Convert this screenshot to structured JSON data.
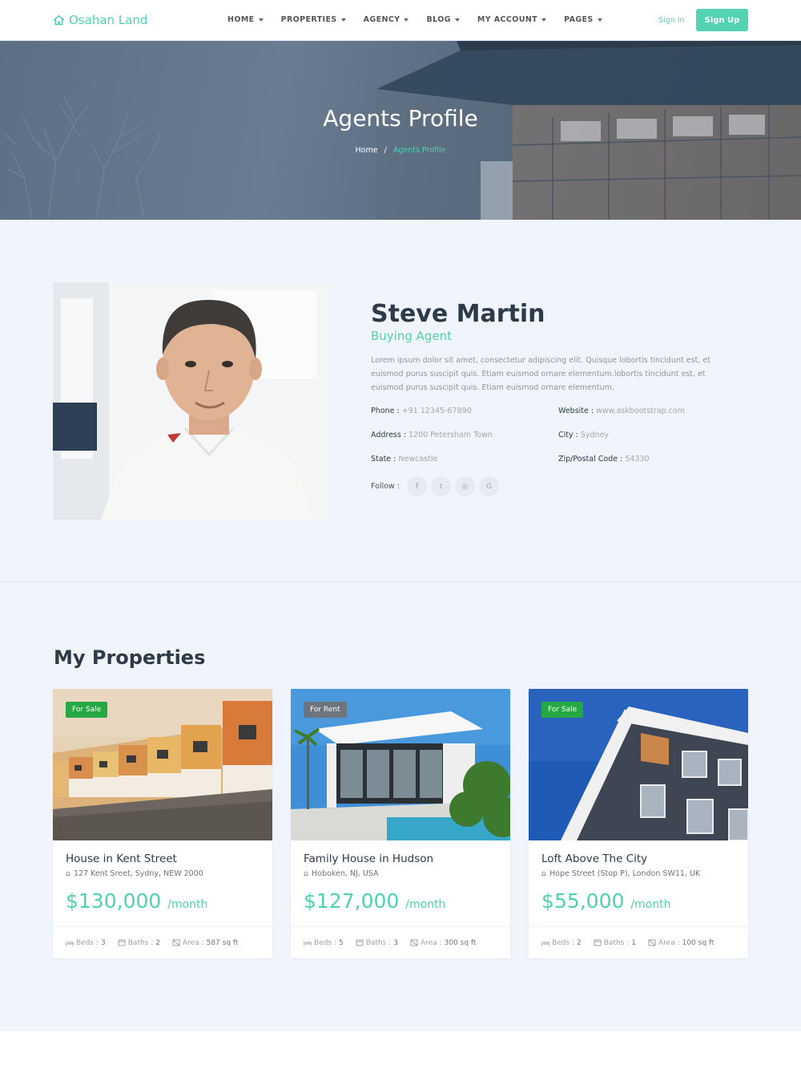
{
  "brand": {
    "name": "Osahan Land"
  },
  "nav": [
    {
      "label": "HOME"
    },
    {
      "label": "PROPERTIES"
    },
    {
      "label": "AGENCY"
    },
    {
      "label": "BLOG"
    },
    {
      "label": "MY ACCOUNT"
    },
    {
      "label": "PAGES"
    }
  ],
  "auth": {
    "sign_in": "Sign In",
    "sign_up": "Sign Up"
  },
  "hero": {
    "title": "Agents Profile",
    "crumb_home": "Home",
    "crumb_sep": "/",
    "crumb_active": "Agents Profile"
  },
  "agent": {
    "name": "Steve Martin",
    "role": "Buying Agent",
    "bio": "Lorem ipsum dolor sit amet, consectetur adipiscing elit. Quisque lobortis tincidunt est, et euismod purus suscipit quis. Etiam euismod ornare elementum.lobortis tincidunt est, et euismod purus suscipit quis. Etiam euismod ornare elementum.",
    "phone_label": "Phone :",
    "phone": "+91 12345-67890",
    "website_label": "Website :",
    "website": "www.askbootstrap.com",
    "address_label": "Address :",
    "address": "1200 Petersham Town",
    "city_label": "City :",
    "city": "Sydney",
    "state_label": "State :",
    "state": "Newcastle",
    "zip_label": "Zip/Postal Code :",
    "zip": "54330",
    "follow_label": "Follow :",
    "social": [
      {
        "icon": "facebook-icon",
        "glyph": "f"
      },
      {
        "icon": "twitter-icon",
        "glyph": "t"
      },
      {
        "icon": "instagram-icon",
        "glyph": "◎"
      },
      {
        "icon": "google-icon",
        "glyph": "G"
      }
    ]
  },
  "properties": {
    "title": "My Properties",
    "items": [
      {
        "badge": "For Sale",
        "title": "House in Kent Street",
        "address": "127 Kent Sreet, Sydny, NEW 2000",
        "price": "$130,000",
        "period": "/month",
        "beds_label": "Beds :",
        "beds": "3",
        "baths_label": "Baths :",
        "baths": "2",
        "area_label": "Area :",
        "area": "587 sq ft"
      },
      {
        "badge": "For Rent",
        "title": "Family House in Hudson",
        "address": "Hoboken, NJ, USA",
        "price": "$127,000",
        "period": "/month",
        "beds_label": "Beds :",
        "beds": "5",
        "baths_label": "Baths :",
        "baths": "3",
        "area_label": "Area :",
        "area": "300 sq ft"
      },
      {
        "badge": "For Sale",
        "title": "Loft Above The City",
        "address": "Hope Street (Stop P), London SW11, UK",
        "price": "$55,000",
        "period": "/month",
        "beds_label": "Beds :",
        "beds": "2",
        "baths_label": "Baths :",
        "baths": "1",
        "area_label": "Area :",
        "area": "100 sq ft"
      }
    ]
  },
  "colors": {
    "accent": "#4fd1b1",
    "sale_badge": "#28a745",
    "rent_badge": "#6c757d",
    "section_bg": "#f0f4fd"
  }
}
